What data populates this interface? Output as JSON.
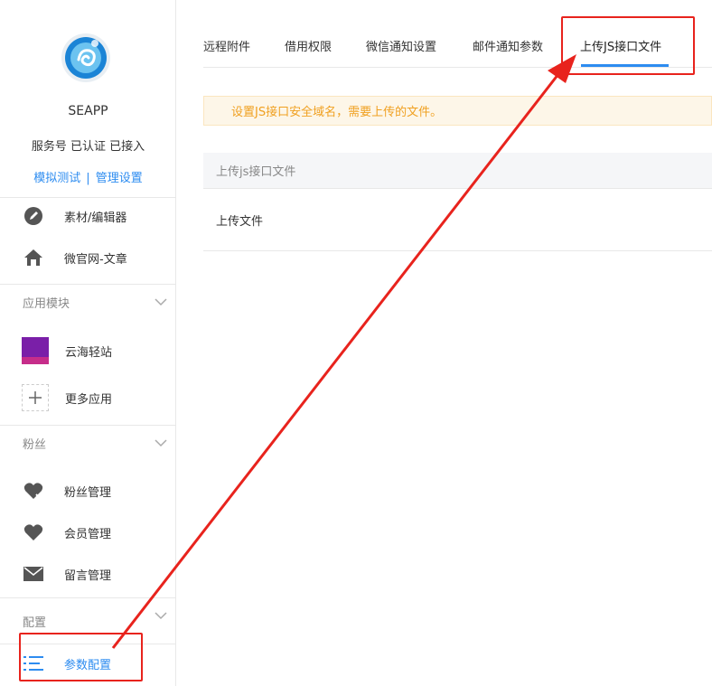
{
  "sidebar": {
    "account": {
      "name": "SEAPP",
      "status": "服务号 已认证 已接入",
      "link_test": "模拟测试",
      "link_sep": "|",
      "link_manage": "管理设置"
    },
    "items_top": [
      {
        "label": "素材/编辑器",
        "icon": "pencil-icon"
      },
      {
        "label": "微官网-文章",
        "icon": "home-icon"
      }
    ],
    "section_apps": "应用模块",
    "apps": [
      {
        "label": "云海轻站",
        "icon": "app-logo-icon",
        "badge_text": "云海轻站"
      },
      {
        "label": "更多应用",
        "icon": "plus-icon"
      }
    ],
    "section_fans": "粉丝",
    "fans": [
      {
        "label": "粉丝管理",
        "icon": "heart-tag-icon"
      },
      {
        "label": "会员管理",
        "icon": "heart-icon"
      },
      {
        "label": "留言管理",
        "icon": "mail-icon"
      }
    ],
    "section_config": "配置",
    "config": [
      {
        "label": "参数配置",
        "icon": "list-icon",
        "active": true
      }
    ]
  },
  "tabs": [
    {
      "label": "远程附件"
    },
    {
      "label": "借用权限"
    },
    {
      "label": "微信通知设置"
    },
    {
      "label": "邮件通知参数"
    },
    {
      "label": "上传JS接口文件",
      "active": true
    }
  ],
  "notice": "设置JS接口安全域名，需要上传的文件。",
  "table": {
    "header": "上传js接口文件",
    "row": "上传文件"
  },
  "colors": {
    "accent": "#2d8cf0",
    "highlight": "#e8231d",
    "notice_text": "#f0a020"
  }
}
